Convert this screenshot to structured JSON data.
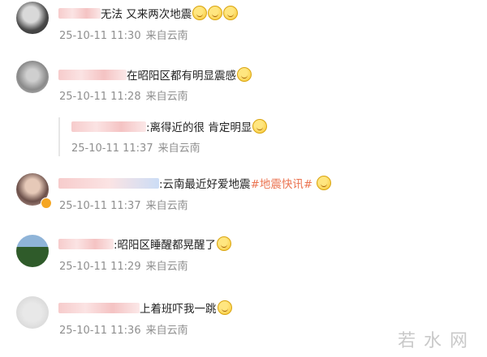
{
  "comments": [
    {
      "text": "无法 又来两次地震",
      "emoji_count": 3,
      "time": "25-10-11 11:30",
      "location": "来自云南"
    },
    {
      "text": "在昭阳区都有明显震感",
      "emoji_count": 1,
      "time": "25-10-11 11:28",
      "location": "来自云南"
    },
    {
      "text": ":离得近的很 肯定明显",
      "emoji_count": 1,
      "time": "25-10-11 11:37",
      "location": "来自云南",
      "is_reply": true
    },
    {
      "text": ":云南最近好爱地震",
      "hashtag": "#地震快讯#",
      "emoji_count": 1,
      "time": "25-10-11 11:37",
      "location": "来自云南"
    },
    {
      "text": ":昭阳区睡醒都晃醒了",
      "emoji_count": 1,
      "time": "25-10-11 11:29",
      "location": "来自云南"
    },
    {
      "text": "上着班吓我一跳",
      "emoji_count": 1,
      "time": "25-10-11 11:36",
      "location": "来自云南"
    }
  ],
  "watermark": "若水网",
  "colors": {
    "meta": "#8f8f8f",
    "hashtag": "#eb7350"
  }
}
